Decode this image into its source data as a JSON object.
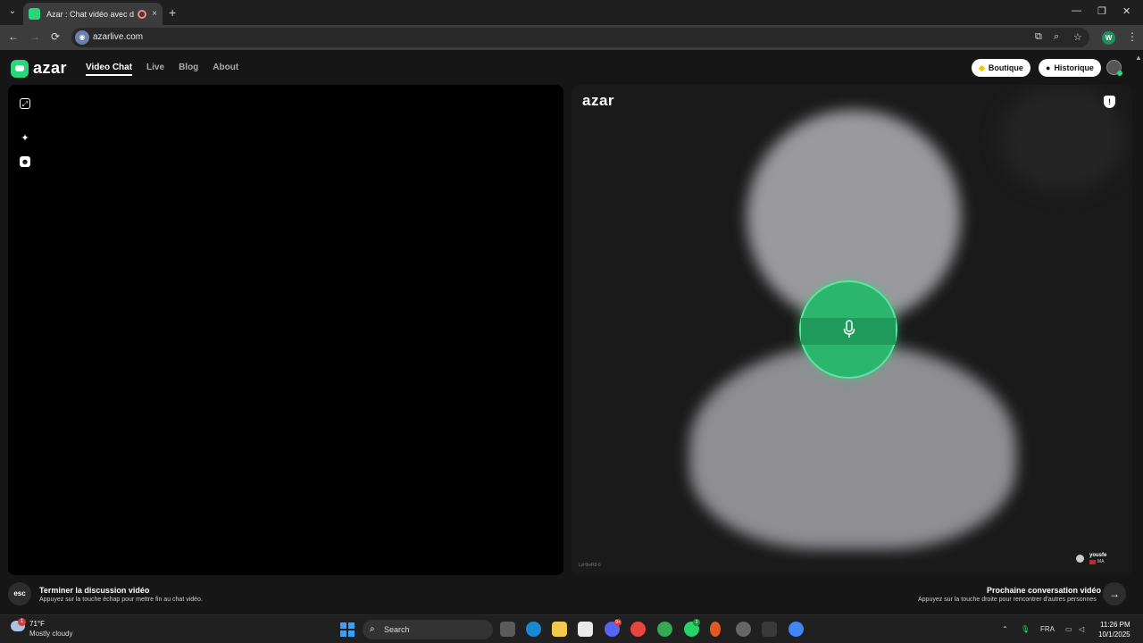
{
  "browser": {
    "tab_title": "Azar : Chat vidéo avec de n",
    "tab_close": "×",
    "new_tab": "+",
    "url": "azarlive.com",
    "profile_initial": "W",
    "window_controls": {
      "minimize": "—",
      "restore": "❐",
      "close": "✕"
    },
    "nav": {
      "back": "←",
      "forward": "→",
      "reload": "⟳"
    },
    "menu": "⋮"
  },
  "site": {
    "logo_text": "azar",
    "nav_items": [
      "Video Chat",
      "Live",
      "Blog",
      "About"
    ],
    "active_nav": "Video Chat",
    "shop_label": "Boutique",
    "history_label": "Historique"
  },
  "remote_video": {
    "watermark": "azar",
    "user_id": "LyHbvR8-6",
    "user_name": "yousfe",
    "user_country": "MA"
  },
  "footer": {
    "esc_key": "esc",
    "end_title": "Terminer la discussion vidéo",
    "end_hint": "Appuyez sur la touche échap pour mettre fin au chat vidéo.",
    "next_title": "Prochaine conversation vidéo",
    "next_hint": "Appuyez sur la touche droite pour rencontrer d'autres personnes",
    "next_arrow": "→"
  },
  "taskbar": {
    "temperature": "71°F",
    "condition": "Mostly cloudy",
    "weather_badge": "1",
    "search_label": "Search",
    "language": "FRA",
    "time": "11:26 PM",
    "date": "10/1/2025",
    "badges": {
      "discord": "9+",
      "whatsapp": "3"
    }
  },
  "colors": {
    "accent": "#2bd67b",
    "mic_green": "#2bb56d"
  }
}
